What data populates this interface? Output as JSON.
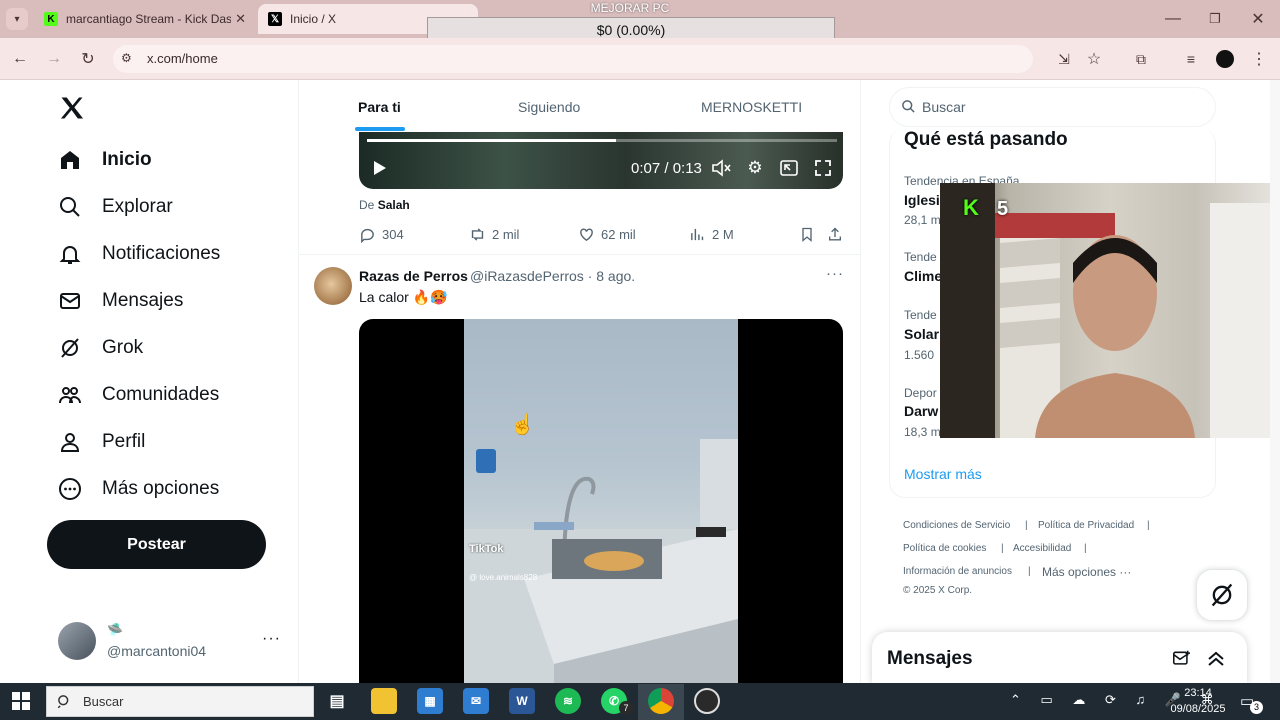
{
  "browser": {
    "tabs": [
      {
        "title": "marcantiago Stream - Kick Dasl",
        "favicon": "kick-icon",
        "active": false
      },
      {
        "title": "Inicio / X",
        "favicon": "x-icon",
        "active": true
      }
    ],
    "url": "x.com/home"
  },
  "overlay": {
    "promo_title": "MEJORAR PC",
    "promo_value": "$0 (0.00%)",
    "kick_viewers": "5"
  },
  "sidebar": {
    "items": [
      {
        "label": "Inicio",
        "icon": "home-icon"
      },
      {
        "label": "Explorar",
        "icon": "search-icon"
      },
      {
        "label": "Notificaciones",
        "icon": "bell-icon"
      },
      {
        "label": "Mensajes",
        "icon": "mail-icon"
      },
      {
        "label": "Grok",
        "icon": "grok-icon"
      },
      {
        "label": "Comunidades",
        "icon": "communities-icon"
      },
      {
        "label": "Perfil",
        "icon": "person-icon"
      },
      {
        "label": "Más opciones",
        "icon": "more-circle-icon"
      }
    ],
    "post_button": "Postear",
    "account": {
      "emoji": "🛸",
      "handle": "@marcantoni04"
    }
  },
  "feed": {
    "tabs": [
      "Para ti",
      "Siguiendo",
      "MERNOSKETTI"
    ],
    "video1": {
      "time": "0:07 / 0:13",
      "progress": 0.53
    },
    "source_prefix": "De",
    "source_name": "Salah",
    "stats": {
      "replies": "304",
      "reposts": "2 mil",
      "likes": "62 mil",
      "views": "2 M"
    },
    "post": {
      "author": "Razas de Perros",
      "meta": "@iRazasdePerros · 8 ago.",
      "text": "La calor 🔥🥵",
      "watermark": "TikTok",
      "watermark_user": "@ love.animals828"
    }
  },
  "right": {
    "search_placeholder": "Buscar",
    "trends_title": "Qué está pasando",
    "trends": [
      {
        "category": "Tendencia en España",
        "name": "Iglesi",
        "count": "28,1 m"
      },
      {
        "category": "Tende",
        "name": "Clime",
        "count": ""
      },
      {
        "category": "Tende",
        "name": "Solar",
        "count": "1.560"
      },
      {
        "category": "Depor",
        "name": "Darw",
        "count": "18,3 m"
      }
    ],
    "show_more": "Mostrar más",
    "footer": [
      "Condiciones de Servicio",
      "Política de Privacidad",
      "Política de cookies",
      "Accesibilidad",
      "Información de anuncios",
      "Más opciones ···",
      "© 2025 X Corp."
    ],
    "messages_title": "Mensajes"
  },
  "taskbar": {
    "search_placeholder": "Buscar",
    "time": "23:14",
    "date": "09/08/2025",
    "whatsapp_badge": "7",
    "notification_badge": "3"
  },
  "colors": {
    "accent": "#1d9bf0",
    "kick": "#53fc18",
    "chrome": "#d9bcbc"
  }
}
